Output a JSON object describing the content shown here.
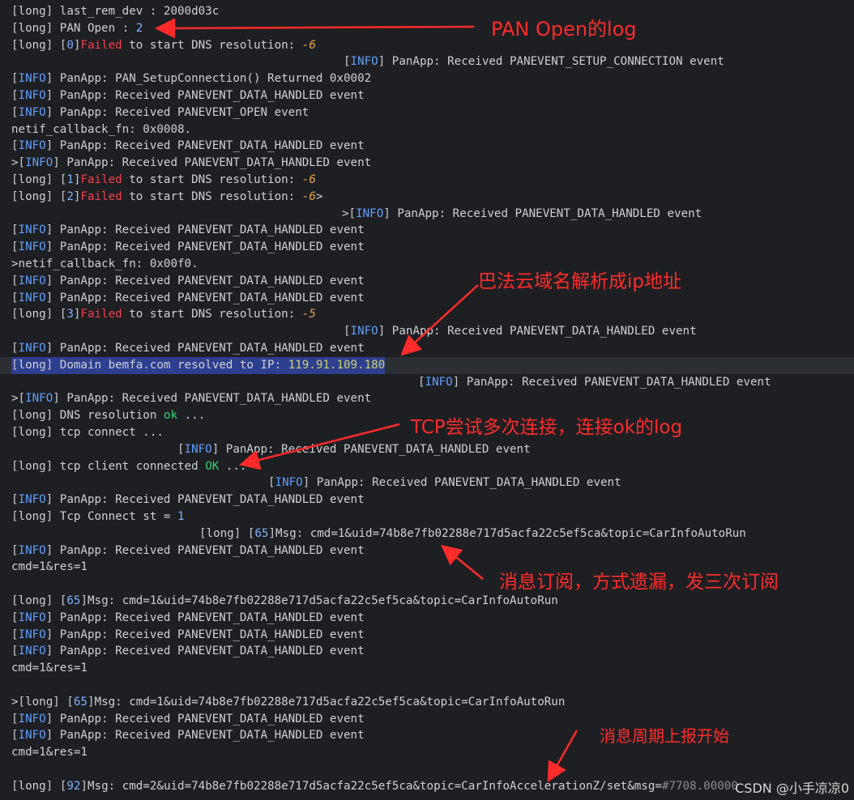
{
  "lines": [
    {
      "segs": [
        [
          "bracket",
          "["
        ],
        [
          "default",
          "long"
        ],
        [
          "bracket",
          "]"
        ],
        [
          "default",
          " last_rem_dev : 2000d03c"
        ]
      ]
    },
    {
      "segs": [
        [
          "bracket",
          "["
        ],
        [
          "default",
          "long"
        ],
        [
          "bracket",
          "]"
        ],
        [
          "default",
          " PAN Open : "
        ],
        [
          "num",
          "2"
        ]
      ]
    },
    {
      "segs": [
        [
          "bracket",
          "["
        ],
        [
          "default",
          "long"
        ],
        [
          "bracket",
          "] ["
        ],
        [
          "num",
          "0"
        ],
        [
          "bracket",
          "]"
        ],
        [
          "red",
          "Failed"
        ],
        [
          "default",
          " to start DNS resolution: "
        ],
        [
          "neg",
          "-6"
        ]
      ]
    },
    {
      "segs": [
        [
          "bracket",
          "["
        ],
        [
          "tag",
          "INFO"
        ],
        [
          "bracket",
          "]"
        ],
        [
          "default",
          " PanApp: Received PANEVENT_SETUP_CONNECTION event"
        ]
      ]
    },
    {
      "segs": [
        [
          "bracket",
          "["
        ],
        [
          "tag",
          "INFO"
        ],
        [
          "bracket",
          "]"
        ],
        [
          "default",
          " PanApp: PAN_SetupConnection() Returned 0x0002"
        ]
      ]
    },
    {
      "segs": [
        [
          "bracket",
          "["
        ],
        [
          "tag",
          "INFO"
        ],
        [
          "bracket",
          "]"
        ],
        [
          "default",
          " PanApp: Received PANEVENT_DATA_HANDLED event"
        ]
      ]
    },
    {
      "segs": [
        [
          "bracket",
          "["
        ],
        [
          "tag",
          "INFO"
        ],
        [
          "bracket",
          "]"
        ],
        [
          "default",
          " PanApp: Received PANEVENT_OPEN event"
        ]
      ]
    },
    {
      "segs": [
        [
          "default",
          "netif_callback_fn: 0x0008."
        ]
      ]
    },
    {
      "segs": [
        [
          "bracket",
          "["
        ],
        [
          "tag",
          "INFO"
        ],
        [
          "bracket",
          "]"
        ],
        [
          "default",
          " PanApp: Received PANEVENT_DATA_HANDLED event"
        ]
      ]
    },
    {
      "segs": [
        [
          "default",
          ">"
        ],
        [
          "bracket",
          "["
        ],
        [
          "tag",
          "INFO"
        ],
        [
          "bracket",
          "]"
        ],
        [
          "default",
          " PanApp: Received PANEVENT_DATA_HANDLED event"
        ]
      ]
    },
    {
      "segs": [
        [
          "bracket",
          "["
        ],
        [
          "default",
          "long"
        ],
        [
          "bracket",
          "] ["
        ],
        [
          "num",
          "1"
        ],
        [
          "bracket",
          "]"
        ],
        [
          "red",
          "Failed"
        ],
        [
          "default",
          " to start DNS resolution: "
        ],
        [
          "neg",
          "-6"
        ]
      ]
    },
    {
      "segs": [
        [
          "bracket",
          "["
        ],
        [
          "default",
          "long"
        ],
        [
          "bracket",
          "] ["
        ],
        [
          "num",
          "2"
        ],
        [
          "bracket",
          "]"
        ],
        [
          "red",
          "Failed"
        ],
        [
          "default",
          " to start DNS resolution: "
        ],
        [
          "neg",
          "-6"
        ],
        [
          "default",
          ">"
        ]
      ]
    },
    {
      "segs": [
        [
          "default",
          ">"
        ],
        [
          "bracket",
          "["
        ],
        [
          "tag",
          "INFO"
        ],
        [
          "bracket",
          "]"
        ],
        [
          "default",
          " PanApp: Received PANEVENT_DATA_HANDLED event"
        ]
      ]
    },
    {
      "segs": [
        [
          "bracket",
          "["
        ],
        [
          "tag",
          "INFO"
        ],
        [
          "bracket",
          "]"
        ],
        [
          "default",
          " PanApp: Received PANEVENT_DATA_HANDLED event"
        ]
      ]
    },
    {
      "segs": [
        [
          "bracket",
          "["
        ],
        [
          "tag",
          "INFO"
        ],
        [
          "bracket",
          "]"
        ],
        [
          "default",
          " PanApp: Received PANEVENT_DATA_HANDLED event"
        ]
      ]
    },
    {
      "segs": [
        [
          "default",
          ">netif_callback_fn: 0x00f0."
        ]
      ]
    },
    {
      "segs": [
        [
          "bracket",
          "["
        ],
        [
          "tag",
          "INFO"
        ],
        [
          "bracket",
          "]"
        ],
        [
          "default",
          " PanApp: Received PANEVENT_DATA_HANDLED event"
        ]
      ]
    },
    {
      "segs": [
        [
          "bracket",
          "["
        ],
        [
          "tag",
          "INFO"
        ],
        [
          "bracket",
          "]"
        ],
        [
          "default",
          " PanApp: Received PANEVENT_DATA_HANDLED event"
        ]
      ]
    },
    {
      "segs": [
        [
          "bracket",
          "["
        ],
        [
          "default",
          "long"
        ],
        [
          "bracket",
          "] ["
        ],
        [
          "num",
          "3"
        ],
        [
          "bracket",
          "]"
        ],
        [
          "red",
          "Failed"
        ],
        [
          "default",
          " to start DNS resolution: "
        ],
        [
          "neg",
          "-5"
        ]
      ]
    },
    {
      "segs": [
        [
          "bracket",
          "["
        ],
        [
          "tag",
          "INFO"
        ],
        [
          "bracket",
          "]"
        ],
        [
          "default",
          " PanApp: Received PANEVENT_DATA_HANDLED event"
        ]
      ]
    },
    {
      "segs": [
        [
          "bracket",
          "["
        ],
        [
          "tag",
          "INFO"
        ],
        [
          "bracket",
          "]"
        ],
        [
          "default",
          " PanApp: Received PANEVENT_DATA_HANDLED event"
        ]
      ]
    },
    {
      "segs": [
        [
          "bracket",
          "["
        ],
        [
          "default",
          "long"
        ],
        [
          "bracket",
          "]"
        ],
        [
          "default",
          " Domain bemfa.com resolved to IP: "
        ],
        [
          "ip",
          "119.91.109.180"
        ]
      ]
    },
    {
      "segs": [
        [
          "bracket",
          "["
        ],
        [
          "tag",
          "INFO"
        ],
        [
          "bracket",
          "]"
        ],
        [
          "default",
          " PanApp: Received PANEVENT_DATA_HANDLED event"
        ]
      ]
    },
    {
      "segs": [
        [
          "default",
          ">"
        ],
        [
          "bracket",
          "["
        ],
        [
          "tag",
          "INFO"
        ],
        [
          "bracket",
          "]"
        ],
        [
          "default",
          " PanApp: Received PANEVENT_DATA_HANDLED event"
        ]
      ]
    },
    {
      "segs": [
        [
          "bracket",
          "["
        ],
        [
          "default",
          "long"
        ],
        [
          "bracket",
          "]"
        ],
        [
          "default",
          " DNS resolution "
        ],
        [
          "grn",
          "ok"
        ],
        [
          "default",
          " ..."
        ]
      ]
    },
    {
      "segs": [
        [
          "bracket",
          "["
        ],
        [
          "default",
          "long"
        ],
        [
          "bracket",
          "]"
        ],
        [
          "default",
          " tcp connect ..."
        ]
      ]
    },
    {
      "segs": [
        [
          "bracket",
          "["
        ],
        [
          "tag",
          "INFO"
        ],
        [
          "bracket",
          "]"
        ],
        [
          "default",
          " PanApp: Received PANEVENT_DATA_HANDLED event"
        ]
      ]
    },
    {
      "segs": [
        [
          "bracket",
          "["
        ],
        [
          "default",
          "long"
        ],
        [
          "bracket",
          "]"
        ],
        [
          "default",
          " tcp client connected "
        ],
        [
          "grn",
          "OK"
        ],
        [
          "default",
          " ..."
        ]
      ]
    },
    {
      "segs": [
        [
          "bracket",
          "["
        ],
        [
          "tag",
          "INFO"
        ],
        [
          "bracket",
          "]"
        ],
        [
          "default",
          " PanApp: Received PANEVENT_DATA_HANDLED event"
        ]
      ]
    },
    {
      "segs": [
        [
          "bracket",
          "["
        ],
        [
          "tag",
          "INFO"
        ],
        [
          "bracket",
          "]"
        ],
        [
          "default",
          " PanApp: Received PANEVENT_DATA_HANDLED event"
        ]
      ]
    },
    {
      "segs": [
        [
          "bracket",
          "["
        ],
        [
          "default",
          "long"
        ],
        [
          "bracket",
          "]"
        ],
        [
          "default",
          " Tcp Connect st = "
        ],
        [
          "num",
          "1"
        ]
      ]
    },
    {
      "segs": [
        [
          "bracket",
          "["
        ],
        [
          "default",
          "long"
        ],
        [
          "bracket",
          "] ["
        ],
        [
          "num",
          "65"
        ],
        [
          "bracket",
          "]"
        ],
        [
          "default",
          "Msg: cmd=1&uid=74b8e7fb02288e717d5acfa22c5ef5ca&topic=CarInfoAutoRun"
        ]
      ]
    },
    {
      "segs": [
        [
          "bracket",
          "["
        ],
        [
          "tag",
          "INFO"
        ],
        [
          "bracket",
          "]"
        ],
        [
          "default",
          " PanApp: Received PANEVENT_DATA_HANDLED event"
        ]
      ]
    },
    {
      "segs": [
        [
          "default",
          "cmd=1&res=1"
        ]
      ]
    },
    {
      "segs": []
    },
    {
      "segs": [
        [
          "bracket",
          "["
        ],
        [
          "default",
          "long"
        ],
        [
          "bracket",
          "] ["
        ],
        [
          "num",
          "65"
        ],
        [
          "bracket",
          "]"
        ],
        [
          "default",
          "Msg: cmd=1&uid=74b8e7fb02288e717d5acfa22c5ef5ca&topic=CarInfoAutoRun"
        ]
      ]
    },
    {
      "segs": [
        [
          "bracket",
          "["
        ],
        [
          "tag",
          "INFO"
        ],
        [
          "bracket",
          "]"
        ],
        [
          "default",
          " PanApp: Received PANEVENT_DATA_HANDLED event"
        ]
      ]
    },
    {
      "segs": [
        [
          "bracket",
          "["
        ],
        [
          "tag",
          "INFO"
        ],
        [
          "bracket",
          "]"
        ],
        [
          "default",
          " PanApp: Received PANEVENT_DATA_HANDLED event"
        ]
      ]
    },
    {
      "segs": [
        [
          "bracket",
          "["
        ],
        [
          "tag",
          "INFO"
        ],
        [
          "bracket",
          "]"
        ],
        [
          "default",
          " PanApp: Received PANEVENT_DATA_HANDLED event"
        ]
      ]
    },
    {
      "segs": [
        [
          "default",
          "cmd=1&res=1"
        ]
      ]
    },
    {
      "segs": []
    },
    {
      "segs": [
        [
          "default",
          ">"
        ],
        [
          "bracket",
          "["
        ],
        [
          "default",
          "long"
        ],
        [
          "bracket",
          "] ["
        ],
        [
          "num",
          "65"
        ],
        [
          "bracket",
          "]"
        ],
        [
          "default",
          "Msg: cmd=1&uid=74b8e7fb02288e717d5acfa22c5ef5ca&topic=CarInfoAutoRun"
        ]
      ]
    },
    {
      "segs": [
        [
          "bracket",
          "["
        ],
        [
          "tag",
          "INFO"
        ],
        [
          "bracket",
          "]"
        ],
        [
          "default",
          " PanApp: Received PANEVENT_DATA_HANDLED event"
        ]
      ]
    },
    {
      "segs": [
        [
          "bracket",
          "["
        ],
        [
          "tag",
          "INFO"
        ],
        [
          "bracket",
          "]"
        ],
        [
          "default",
          " PanApp: Received PANEVENT_DATA_HANDLED event"
        ]
      ]
    },
    {
      "segs": [
        [
          "default",
          "cmd=1&res=1"
        ]
      ]
    },
    {
      "segs": []
    },
    {
      "segs": [
        [
          "bracket",
          "["
        ],
        [
          "default",
          "long"
        ],
        [
          "bracket",
          "] ["
        ],
        [
          "num",
          "92"
        ],
        [
          "bracket",
          "]"
        ],
        [
          "default",
          "Msg: cmd=2&uid=74b8e7fb02288e717d5acfa22c5ef5ca&topic=CarInfoAccelerationZ/set&msg="
        ],
        [
          "dim",
          "#7708.00000"
        ]
      ]
    }
  ],
  "annotations": [
    {
      "text": "PAN Open的log"
    },
    {
      "text": "巴法云域名解析成ip地址"
    },
    {
      "text": "TCP尝试多次连接，连接ok的log"
    },
    {
      "text": "消息订阅，方式遗漏，发三次订阅"
    },
    {
      "text": "消息周期上报开始"
    }
  ],
  "watermark": "CSDN @小手凉凉0",
  "colors": {
    "background": "#1e1f22",
    "tag": "#5f9fff",
    "failed": "#f0404e",
    "ok": "#33d17a",
    "annotation": "#ff2b2b"
  }
}
